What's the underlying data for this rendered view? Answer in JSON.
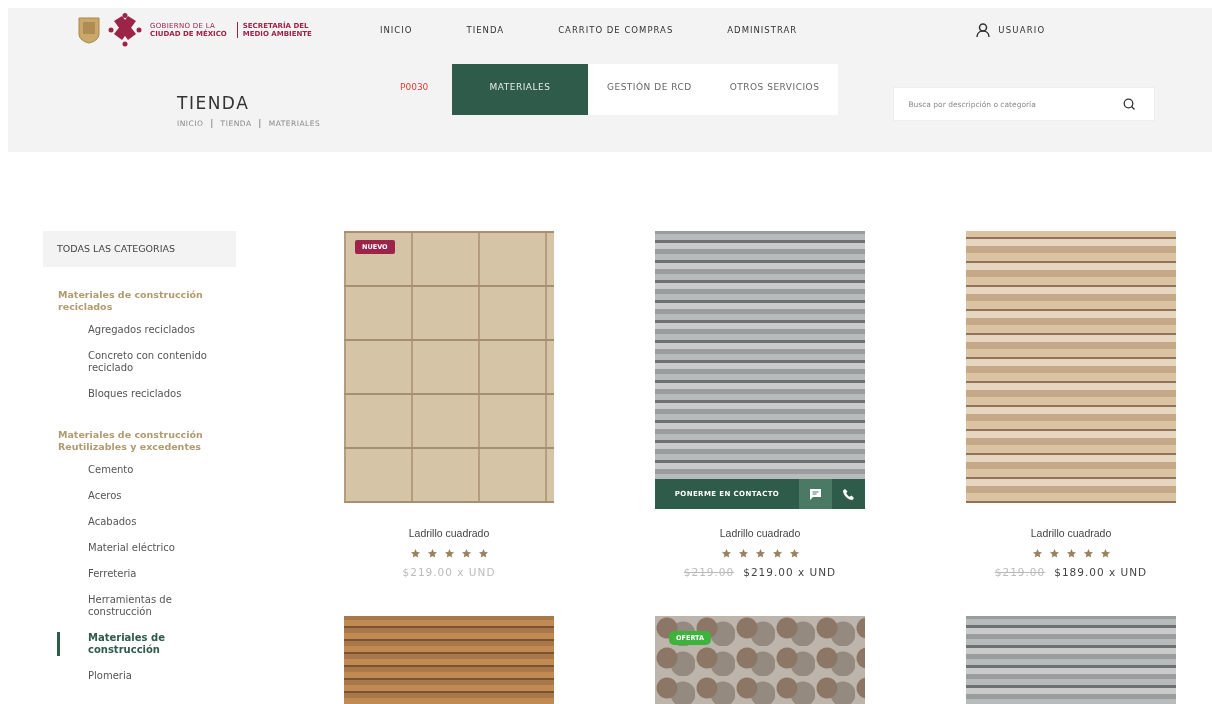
{
  "header": {
    "logo": {
      "line_1": "GOBIERNO DE LA",
      "line_2": "CIUDAD DE MÉXICO",
      "secretaria_1": "SECRETARÍA DEL",
      "secretaria_2": "MEDIO AMBIENTE"
    },
    "nav": [
      {
        "label": "INICIO"
      },
      {
        "label": "TIENDA"
      },
      {
        "label": "CARRITO DE COMPRAS"
      },
      {
        "label": "ADMINISTRAR"
      }
    ],
    "user": {
      "label": "USUARIO"
    }
  },
  "page": {
    "title": "TIENDA",
    "breadcrumb": [
      {
        "kind": "link",
        "text": "INICIO"
      },
      {
        "kind": "separator",
        "text": "|"
      },
      {
        "kind": "link",
        "text": "TIENDA"
      },
      {
        "kind": "separator",
        "text": "|"
      },
      {
        "kind": "link",
        "text": "MATERIALES"
      }
    ],
    "code": "P0030",
    "tabs": [
      {
        "label": "MATERIALES",
        "selected": true
      },
      {
        "label": "GESTIÓN DE RCD",
        "selected": false
      },
      {
        "label": "OTROS SERVICIOS",
        "selected": false
      }
    ],
    "search": {
      "placeholder": "Busca por descripción o categoría"
    }
  },
  "sidebar": {
    "heading": "TODAS LAS CATEGORIAS",
    "groups": [
      {
        "title": "Materiales de construcción reciclados",
        "children": [
          {
            "label": "Agregados reciclados",
            "selected": false
          },
          {
            "label": "Concreto con contenido reciclado",
            "selected": false
          },
          {
            "label": "Bloques reciclados",
            "selected": false
          }
        ]
      },
      {
        "title": "Materiales de construcción Reutilizables y excedentes",
        "children": [
          {
            "label": "Cemento",
            "selected": false
          },
          {
            "label": "Aceros",
            "selected": false
          },
          {
            "label": "Acabados",
            "selected": false
          },
          {
            "label": "Material eléctrico",
            "selected": false
          },
          {
            "label": "Ferreteria",
            "selected": false
          },
          {
            "label": "Herramientas de construcción",
            "selected": false
          },
          {
            "label": "Materiales de construcción",
            "selected": true
          },
          {
            "label": "Plomeria",
            "selected": false
          }
        ]
      }
    ]
  },
  "products": [
    {
      "kind": "sandstone",
      "badge": {
        "text": "NUEVO",
        "kind": "new"
      },
      "name": "Ladrillo cuadrado",
      "stars": 5,
      "price": "$219.00 x UND"
    },
    {
      "kind": "slate",
      "contact": {
        "label": "PONERME EN CONTACTO"
      },
      "name": "Ladrillo cuadrado",
      "stars": 5,
      "old_price": "$219.00",
      "price": "$219.00 x UND"
    },
    {
      "kind": "ledgestone",
      "name": "Ladrillo cuadrado",
      "stars": 5,
      "old_price": "$219.00",
      "price": "$189.00 x UND"
    },
    {
      "kind": "rust"
    },
    {
      "kind": "pebble",
      "badge": {
        "text": "OFERTA",
        "kind": "sale"
      }
    },
    {
      "kind": "slate"
    }
  ]
}
